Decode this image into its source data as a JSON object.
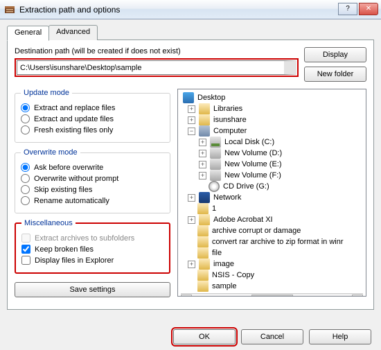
{
  "window": {
    "title": "Extraction path and options"
  },
  "tabs": {
    "general": "General",
    "advanced": "Advanced"
  },
  "dest": {
    "label": "Destination path (will be created if does not exist)",
    "path": "C:\\Users\\isunshare\\Desktop\\sample",
    "display_btn": "Display",
    "newfolder_btn": "New folder"
  },
  "update_mode": {
    "legend": "Update mode",
    "opt1": "Extract and replace files",
    "opt2": "Extract and update files",
    "opt3": "Fresh existing files only"
  },
  "overwrite_mode": {
    "legend": "Overwrite mode",
    "opt1": "Ask before overwrite",
    "opt2": "Overwrite without prompt",
    "opt3": "Skip existing files",
    "opt4": "Rename automatically"
  },
  "misc": {
    "legend": "Miscellaneous",
    "opt1": "Extract archives to subfolders",
    "opt2": "Keep broken files",
    "opt3": "Display files in Explorer"
  },
  "save_settings": "Save settings",
  "tree": {
    "desktop": "Desktop",
    "libraries": "Libraries",
    "isunshare": "isunshare",
    "computer": "Computer",
    "drive_c": "Local Disk (C:)",
    "drive_d": "New Volume (D:)",
    "drive_e": "New Volume (E:)",
    "drive_f": "New Volume (F:)",
    "drive_g": "CD Drive (G:)",
    "network": "Network",
    "n1": "1",
    "adobe": "Adobe Acrobat XI",
    "archive_corrupt": "archive corrupt or damage",
    "convert": "convert rar archive to zip format in winr",
    "file": "file",
    "image": "image",
    "nsis": "NSIS - Copy",
    "sample": "sample"
  },
  "footer": {
    "ok": "OK",
    "cancel": "Cancel",
    "help": "Help"
  }
}
